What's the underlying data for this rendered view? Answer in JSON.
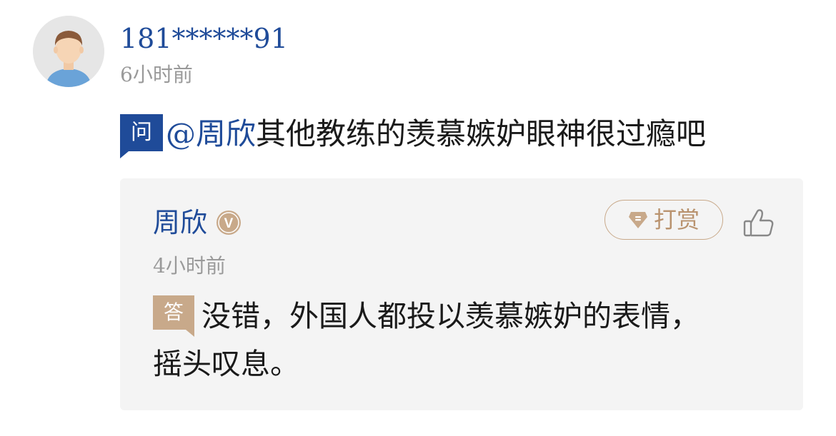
{
  "question_block": {
    "asker": {
      "name": "181******91",
      "time": "6小时前",
      "avatar_icon": "user-avatar-icon"
    },
    "tag": "问",
    "mention": "@周欣",
    "text": "其他教练的羡慕嫉妒眼神很过瘾吧"
  },
  "answer_block": {
    "author": {
      "name": "周欣",
      "verified_badge": "V",
      "time": "4小时前"
    },
    "tip_button": {
      "label": "打赏",
      "icon": "gem-icon"
    },
    "like_icon": "thumbs-up-icon",
    "tag": "答",
    "text": "没错，外国人都投以羡慕嫉妒的表情，摇头叹息。"
  },
  "colors": {
    "brand_blue": "#1f4b99",
    "gold": "#c8a98a",
    "gold_text": "#b9936f",
    "muted_text": "#9a9a9a",
    "card_bg": "#f4f4f4"
  }
}
